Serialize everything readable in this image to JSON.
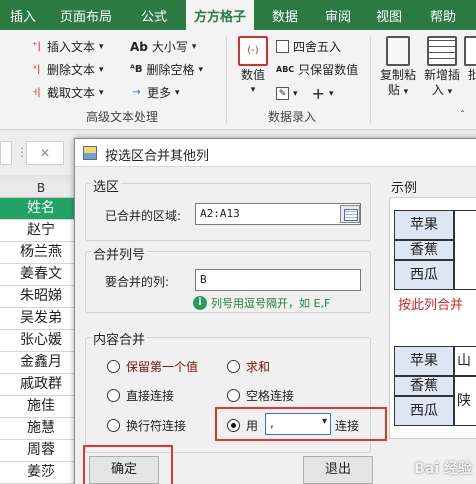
{
  "ribbon": {
    "tabs": [
      "插入",
      "页面布局",
      "公式",
      "方方格子",
      "数据",
      "审阅",
      "视图",
      "帮助"
    ],
    "active_tab": "方方格子",
    "text_group": {
      "items": [
        "插入文本",
        "删除文本",
        "截取文本",
        "大小写",
        "删除空格",
        "更多"
      ],
      "icons": [
        "Ab",
        "ᴬB"
      ],
      "label": "高级文本处理"
    },
    "data_group": {
      "number_button": "数值",
      "items": [
        "四舍五入",
        "只保留数值"
      ],
      "icon": "ABC",
      "label": "数据录入"
    },
    "copy_paste": [
      "复制粘",
      "贴"
    ],
    "insert": [
      "新增插",
      "入"
    ],
    "batch": "批"
  },
  "formula_bar": {
    "close_glyph": "✕"
  },
  "sheet": {
    "column": "B",
    "cells": [
      "姓名",
      "赵宁",
      "杨兰燕",
      "姜春文",
      "朱昭娣",
      "吴发弟",
      "张心媛",
      "金鑫月",
      "戚政群",
      "施佳",
      "施慧",
      "周蓉",
      "姜莎"
    ]
  },
  "dialog": {
    "title": "按选区合并其他列",
    "selection": {
      "legend": "选区",
      "merged_label": "已合并的区域:",
      "merged_value": "A2:A13"
    },
    "merge_col": {
      "legend": "合并列号",
      "label": "要合并的列:",
      "value": "B",
      "hint": "列号用逗号隔开，如 E,F"
    },
    "content": {
      "legend": "内容合并",
      "options": [
        "保留第一个值",
        "求和",
        "直接连接",
        "空格连接",
        "换行符连接"
      ],
      "use_label": "用",
      "connector": ",",
      "connect_label": "连接"
    },
    "ok": "确定",
    "exit": "退出",
    "example": {
      "legend": "示例",
      "top": [
        "苹果",
        "香蕉",
        "西瓜"
      ],
      "note": "按此列合并",
      "bottom": [
        "苹果",
        "香蕉",
        "西瓜"
      ],
      "bottom_right": [
        "山",
        "陕"
      ]
    }
  },
  "watermark": "Bai 经验"
}
